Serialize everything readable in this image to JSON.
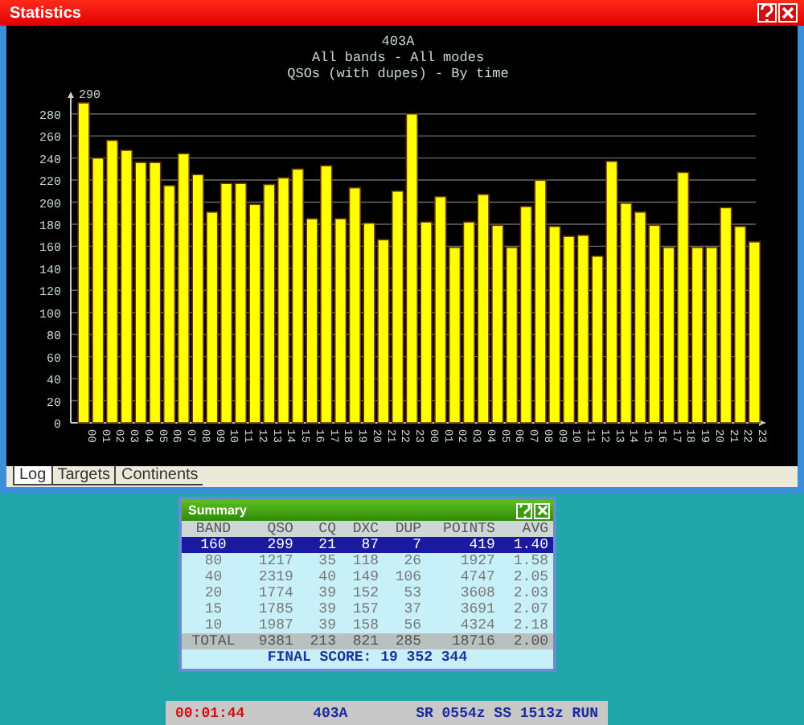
{
  "window": {
    "title": "Statistics"
  },
  "chart": {
    "chart_data": {
      "type": "bar",
      "title": "403A\nAll bands - All modes\nQSOs (with dupes) - By time",
      "categories": [
        "00",
        "01",
        "02",
        "03",
        "04",
        "05",
        "06",
        "07",
        "08",
        "09",
        "10",
        "11",
        "12",
        "13",
        "14",
        "15",
        "16",
        "17",
        "18",
        "19",
        "20",
        "21",
        "22",
        "23",
        "00",
        "01",
        "02",
        "03",
        "04",
        "05",
        "06",
        "07",
        "08",
        "09",
        "10",
        "11",
        "12",
        "13",
        "14",
        "15",
        "16",
        "17",
        "18",
        "19",
        "20",
        "21",
        "22",
        "23"
      ],
      "series": [
        {
          "color": "#ffff00",
          "values": [
            290,
            240,
            256,
            247,
            236,
            236,
            215,
            244,
            225,
            191,
            217,
            217,
            198,
            216,
            222,
            230,
            185,
            233,
            185,
            213,
            181,
            166,
            210,
            280,
            182,
            205,
            159,
            182,
            207,
            179,
            159,
            196,
            220,
            178,
            169,
            170,
            151,
            237,
            199,
            191,
            179,
            159,
            227,
            159,
            159,
            195,
            178,
            164
          ]
        }
      ],
      "ylim": [
        0,
        290
      ],
      "yticks": [
        0,
        20,
        40,
        60,
        80,
        100,
        120,
        140,
        160,
        180,
        200,
        220,
        240,
        260,
        280
      ],
      "grid": true,
      "annotations": [
        {
          "text": "290",
          "x": "00"
        }
      ]
    }
  },
  "tabs": [
    {
      "label": "Log",
      "selected": true
    },
    {
      "label": "Targets",
      "selected": false
    },
    {
      "label": "Continents",
      "selected": false
    }
  ],
  "summary": {
    "title": "Summary",
    "columns": [
      "BAND",
      "QSO",
      "CQ",
      "DXC",
      "DUP",
      "POINTS",
      "AVG"
    ],
    "rows": [
      {
        "cells": [
          "160",
          "299",
          "21",
          "87",
          "7",
          "419",
          "1.40"
        ],
        "selected": true
      },
      {
        "cells": [
          "80",
          "1217",
          "35",
          "118",
          "26",
          "1927",
          "1.58"
        ],
        "selected": false
      },
      {
        "cells": [
          "40",
          "2319",
          "40",
          "149",
          "106",
          "4747",
          "2.05"
        ],
        "selected": false
      },
      {
        "cells": [
          "20",
          "1774",
          "39",
          "152",
          "53",
          "3608",
          "2.03"
        ],
        "selected": false
      },
      {
        "cells": [
          "15",
          "1785",
          "39",
          "157",
          "37",
          "3691",
          "2.07"
        ],
        "selected": false
      },
      {
        "cells": [
          "10",
          "1987",
          "39",
          "158",
          "56",
          "4324",
          "2.18"
        ],
        "selected": false
      }
    ],
    "total": [
      "TOTAL",
      "9381",
      "213",
      "821",
      "285",
      "18716",
      "2.00"
    ],
    "final_score": "FINAL SCORE:  19 352 344"
  },
  "status_bar": {
    "timer": "00:01:44",
    "call": "403A",
    "info": "SR 0554z SS 1513z RUN"
  }
}
